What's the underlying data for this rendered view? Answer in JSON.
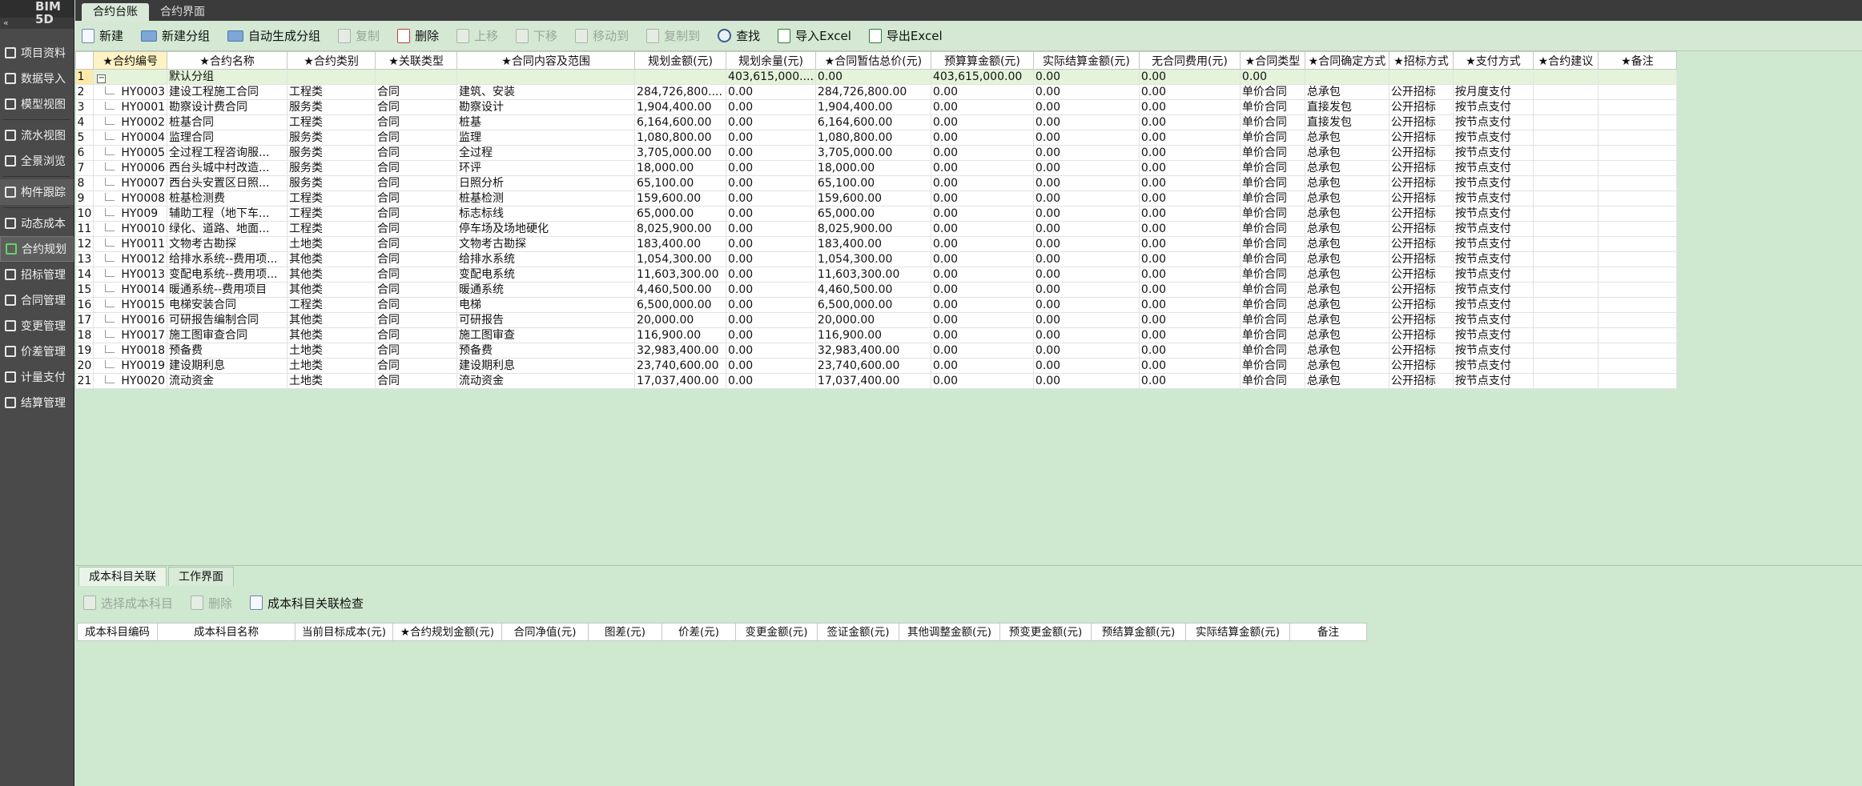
{
  "app": {
    "brand": "BIM 5D",
    "collapse_glyph": "«"
  },
  "sidebar": {
    "items": [
      {
        "label": "项目资料",
        "icon": "folder-icon"
      },
      {
        "label": "数据导入",
        "icon": "import-icon"
      },
      {
        "label": "模型视图",
        "icon": "model-icon"
      },
      {
        "label": "流水视图",
        "icon": "flow-icon"
      },
      {
        "label": "全景浏览",
        "icon": "panorama-icon"
      },
      {
        "label": "构件跟踪",
        "icon": "track-icon"
      },
      {
        "label": "动态成本",
        "icon": "cost-icon"
      },
      {
        "label": "合约规划",
        "icon": "contract-plan-icon"
      },
      {
        "label": "招标管理",
        "icon": "bid-icon"
      },
      {
        "label": "合同管理",
        "icon": "contract-icon"
      },
      {
        "label": "变更管理",
        "icon": "change-icon"
      },
      {
        "label": "价差管理",
        "icon": "price-icon"
      },
      {
        "label": "计量支付",
        "icon": "payment-icon"
      },
      {
        "label": "结算管理",
        "icon": "settlement-icon"
      }
    ]
  },
  "top_tabs": [
    {
      "label": "合约台账"
    },
    {
      "label": "合约界面"
    }
  ],
  "toolbar": {
    "new": "新建",
    "new_group": "新建分组",
    "auto_group": "自动生成分组",
    "copy": "复制",
    "delete": "删除",
    "move_up": "上移",
    "move_down": "下移",
    "move_to": "移动到",
    "copy_to": "复制到",
    "find": "查找",
    "import_excel": "导入Excel",
    "export_excel": "导出Excel"
  },
  "grid": {
    "columns": [
      "★合约编号",
      "★合约名称",
      "★合约类别",
      "★关联类型",
      "★合同内容及范围",
      "规划金额(元)",
      "规划余量(元)",
      "★合同暂估总价(元)",
      "预算算金额(元)",
      "实际结算金额(元)",
      "无合同费用(元)",
      "★合同类型",
      "★合同确定方式",
      "★招标方式",
      "★支付方式",
      "★合约建议",
      "★备注"
    ],
    "group_row": {
      "num": "1",
      "name": "默认分组",
      "plan": "403,615,000....",
      "remain": "0.00",
      "est": "403,615,000.00",
      "budget": "0.00",
      "actual": "0.00",
      "nocontract": "0.00"
    },
    "rows": [
      [
        "2",
        "HY0003",
        "建设工程施工合同",
        "工程类",
        "合同",
        "建筑、安装",
        "284,726,800....",
        "0.00",
        "284,726,800.00",
        "0.00",
        "0.00",
        "0.00",
        "单价合同",
        "总承包",
        "公开招标",
        "按月度支付",
        "",
        ""
      ],
      [
        "3",
        "HY0001",
        "勘察设计费合同",
        "服务类",
        "合同",
        "勘察设计",
        "1,904,400.00",
        "0.00",
        "1,904,400.00",
        "0.00",
        "0.00",
        "0.00",
        "单价合同",
        "直接发包",
        "公开招标",
        "按节点支付",
        "",
        ""
      ],
      [
        "4",
        "HY0002",
        "桩基合同",
        "工程类",
        "合同",
        "桩基",
        "6,164,600.00",
        "0.00",
        "6,164,600.00",
        "0.00",
        "0.00",
        "0.00",
        "单价合同",
        "直接发包",
        "公开招标",
        "按节点支付",
        "",
        ""
      ],
      [
        "5",
        "HY0004",
        "监理合同",
        "服务类",
        "合同",
        "监理",
        "1,080,800.00",
        "0.00",
        "1,080,800.00",
        "0.00",
        "0.00",
        "0.00",
        "单价合同",
        "总承包",
        "公开招标",
        "按节点支付",
        "",
        ""
      ],
      [
        "6",
        "HY0005",
        "全过程工程咨询服...",
        "服务类",
        "合同",
        "全过程",
        "3,705,000.00",
        "0.00",
        "3,705,000.00",
        "0.00",
        "0.00",
        "0.00",
        "单价合同",
        "总承包",
        "公开招标",
        "按节点支付",
        "",
        ""
      ],
      [
        "7",
        "HY0006",
        "西台头城中村改造...",
        "服务类",
        "合同",
        "环评",
        "18,000.00",
        "0.00",
        "18,000.00",
        "0.00",
        "0.00",
        "0.00",
        "单价合同",
        "总承包",
        "公开招标",
        "按节点支付",
        "",
        ""
      ],
      [
        "8",
        "HY0007",
        "西台头安置区日照...",
        "服务类",
        "合同",
        "日照分析",
        "65,100.00",
        "0.00",
        "65,100.00",
        "0.00",
        "0.00",
        "0.00",
        "单价合同",
        "总承包",
        "公开招标",
        "按节点支付",
        "",
        ""
      ],
      [
        "9",
        "HY0008",
        "桩基检测费",
        "工程类",
        "合同",
        "桩基检测",
        "159,600.00",
        "0.00",
        "159,600.00",
        "0.00",
        "0.00",
        "0.00",
        "单价合同",
        "总承包",
        "公开招标",
        "按节点支付",
        "",
        ""
      ],
      [
        "10",
        "HY009",
        "辅助工程（地下车...",
        "工程类",
        "合同",
        "标志标线",
        "65,000.00",
        "0.00",
        "65,000.00",
        "0.00",
        "0.00",
        "0.00",
        "单价合同",
        "总承包",
        "公开招标",
        "按节点支付",
        "",
        ""
      ],
      [
        "11",
        "HY0010",
        "绿化、道路、地面...",
        "工程类",
        "合同",
        "停车场及场地硬化",
        "8,025,900.00",
        "0.00",
        "8,025,900.00",
        "0.00",
        "0.00",
        "0.00",
        "单价合同",
        "总承包",
        "公开招标",
        "按节点支付",
        "",
        ""
      ],
      [
        "12",
        "HY0011",
        "文物考古勘探",
        "土地类",
        "合同",
        "文物考古勘探",
        "183,400.00",
        "0.00",
        "183,400.00",
        "0.00",
        "0.00",
        "0.00",
        "单价合同",
        "总承包",
        "公开招标",
        "按节点支付",
        "",
        ""
      ],
      [
        "13",
        "HY0012",
        "给排水系统--费用项...",
        "其他类",
        "合同",
        "给排水系统",
        "1,054,300.00",
        "0.00",
        "1,054,300.00",
        "0.00",
        "0.00",
        "0.00",
        "单价合同",
        "总承包",
        "公开招标",
        "按节点支付",
        "",
        ""
      ],
      [
        "14",
        "HY0013",
        "变配电系统--费用项...",
        "其他类",
        "合同",
        "变配电系统",
        "11,603,300.00",
        "0.00",
        "11,603,300.00",
        "0.00",
        "0.00",
        "0.00",
        "单价合同",
        "总承包",
        "公开招标",
        "按节点支付",
        "",
        ""
      ],
      [
        "15",
        "HY0014",
        "暖通系统--费用项目",
        "其他类",
        "合同",
        "暖通系统",
        "4,460,500.00",
        "0.00",
        "4,460,500.00",
        "0.00",
        "0.00",
        "0.00",
        "单价合同",
        "总承包",
        "公开招标",
        "按节点支付",
        "",
        ""
      ],
      [
        "16",
        "HY0015",
        "电梯安装合同",
        "工程类",
        "合同",
        "电梯",
        "6,500,000.00",
        "0.00",
        "6,500,000.00",
        "0.00",
        "0.00",
        "0.00",
        "单价合同",
        "总承包",
        "公开招标",
        "按节点支付",
        "",
        ""
      ],
      [
        "17",
        "HY0016",
        "可研报告编制合同",
        "其他类",
        "合同",
        "可研报告",
        "20,000.00",
        "0.00",
        "20,000.00",
        "0.00",
        "0.00",
        "0.00",
        "单价合同",
        "总承包",
        "公开招标",
        "按节点支付",
        "",
        ""
      ],
      [
        "18",
        "HY0017",
        "施工图审查合同",
        "其他类",
        "合同",
        "施工图审查",
        "116,900.00",
        "0.00",
        "116,900.00",
        "0.00",
        "0.00",
        "0.00",
        "单价合同",
        "总承包",
        "公开招标",
        "按节点支付",
        "",
        ""
      ],
      [
        "19",
        "HY0018",
        "预备费",
        "土地类",
        "合同",
        "预备费",
        "32,983,400.00",
        "0.00",
        "32,983,400.00",
        "0.00",
        "0.00",
        "0.00",
        "单价合同",
        "总承包",
        "公开招标",
        "按节点支付",
        "",
        ""
      ],
      [
        "20",
        "HY0019",
        "建设期利息",
        "土地类",
        "合同",
        "建设期利息",
        "23,740,600.00",
        "0.00",
        "23,740,600.00",
        "0.00",
        "0.00",
        "0.00",
        "单价合同",
        "总承包",
        "公开招标",
        "按节点支付",
        "",
        ""
      ],
      [
        "21",
        "HY0020",
        "流动资金",
        "土地类",
        "合同",
        "流动资金",
        "17,037,400.00",
        "0.00",
        "17,037,400.00",
        "0.00",
        "0.00",
        "0.00",
        "单价合同",
        "总承包",
        "公开招标",
        "按节点支付",
        "",
        ""
      ]
    ]
  },
  "bottom": {
    "tabs": [
      {
        "label": "成本科目关联"
      },
      {
        "label": "工作界面"
      }
    ],
    "toolbar": {
      "select_subject": "选择成本科目",
      "delete": "删除",
      "check": "成本科目关联检查"
    },
    "columns": [
      "成本科目编码",
      "成本科目名称",
      "当前目标成本(元)",
      "★合约规划金额(元)",
      "合同净值(元)",
      "图差(元)",
      "价差(元)",
      "变更金额(元)",
      "签证金额(元)",
      "其他调整金额(元)",
      "预变更金额(元)",
      "预结算金额(元)",
      "实际结算金额(元)",
      "备注"
    ]
  }
}
